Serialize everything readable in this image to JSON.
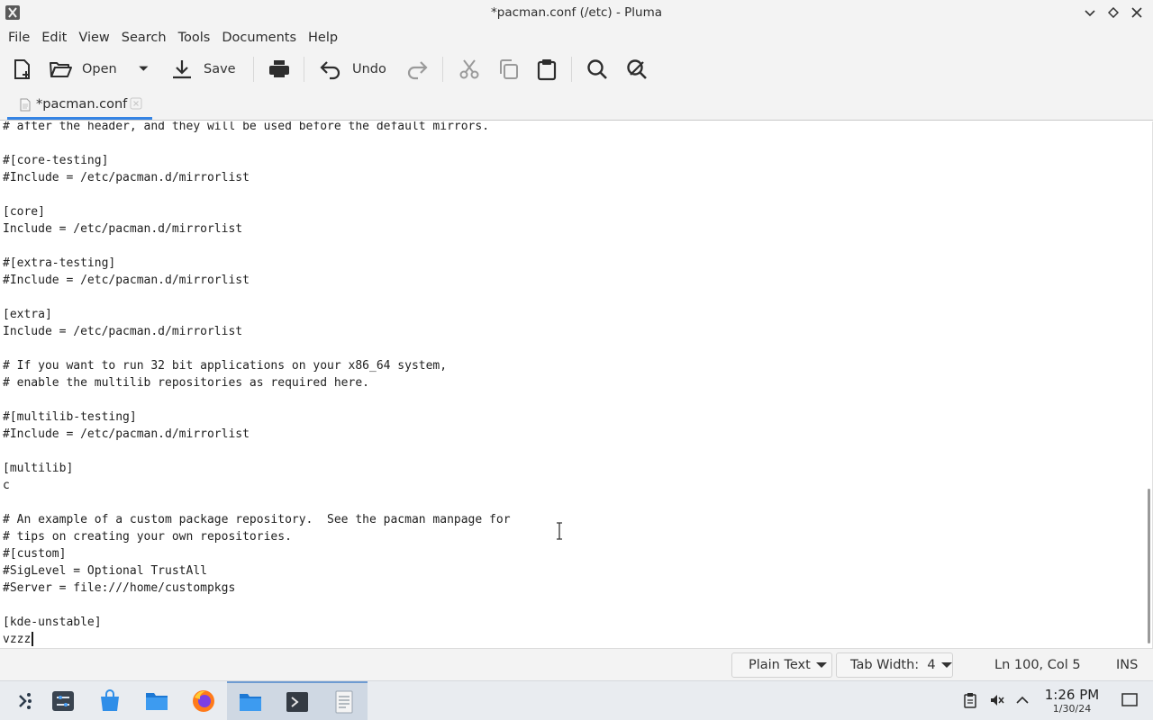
{
  "window": {
    "title": "*pacman.conf (/etc) - Pluma"
  },
  "menu": {
    "items": [
      "File",
      "Edit",
      "View",
      "Search",
      "Tools",
      "Documents",
      "Help"
    ]
  },
  "toolbar": {
    "open_label": "Open",
    "save_label": "Save",
    "undo_label": "Undo"
  },
  "tab": {
    "label": "*pacman.conf"
  },
  "editor": {
    "lines": [
      "# after the header, and they will be used before the default mirrors.",
      "",
      "#[core-testing]",
      "#Include = /etc/pacman.d/mirrorlist",
      "",
      "[core]",
      "Include = /etc/pacman.d/mirrorlist",
      "",
      "#[extra-testing]",
      "#Include = /etc/pacman.d/mirrorlist",
      "",
      "[extra]",
      "Include = /etc/pacman.d/mirrorlist",
      "",
      "# If you want to run 32 bit applications on your x86_64 system,",
      "# enable the multilib repositories as required here.",
      "",
      "#[multilib-testing]",
      "#Include = /etc/pacman.d/mirrorlist",
      "",
      "[multilib]",
      "c",
      "",
      "# An example of a custom package repository.  See the pacman manpage for",
      "# tips on creating your own repositories.",
      "#[custom]",
      "#SigLevel = Optional TrustAll",
      "#Server = file:///home/custompkgs",
      "",
      "[kde-unstable]",
      "vzzz"
    ]
  },
  "status": {
    "language": "Plain Text",
    "tab_width": "Tab Width:  4",
    "position": "Ln 100, Col 5",
    "mode": "INS"
  },
  "clock": {
    "time": "1:26 PM",
    "date": "1/30/24"
  },
  "colors": {
    "accent": "#3584e4",
    "chrome_bg": "#f3f3f3",
    "taskbar_bg": "#e9ecf0"
  }
}
